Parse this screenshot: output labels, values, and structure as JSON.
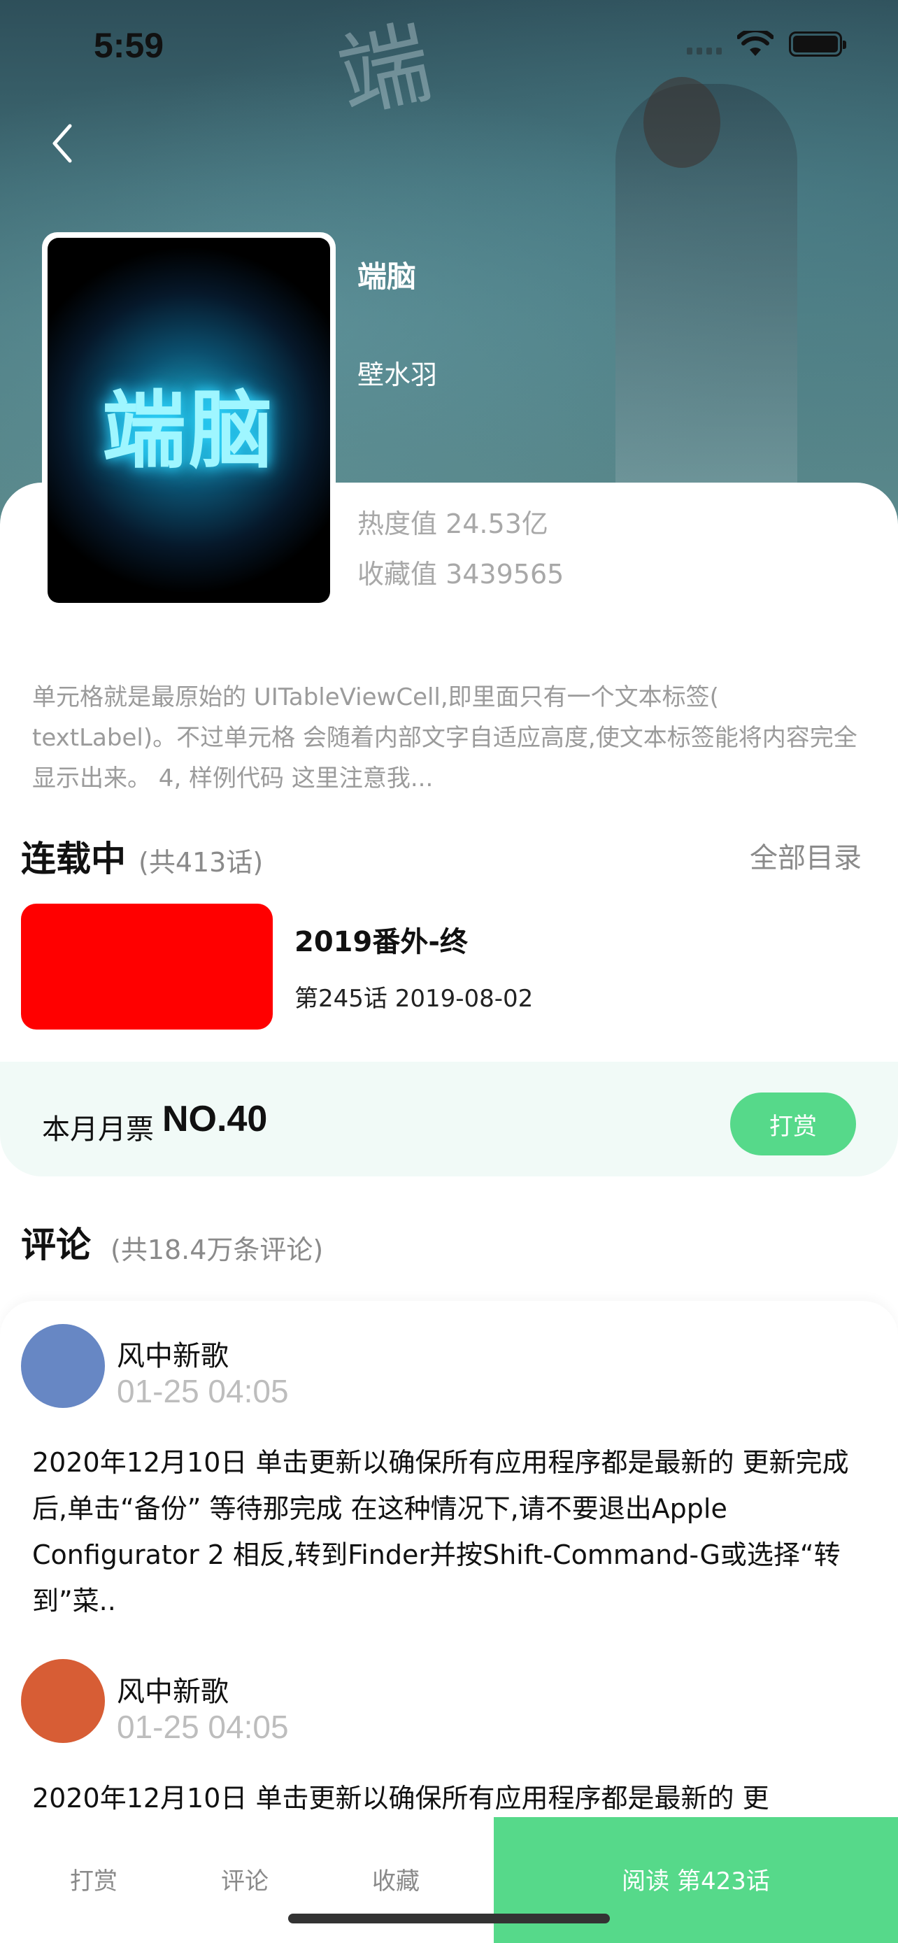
{
  "status": {
    "time": "5:59"
  },
  "comic": {
    "title": "端脑",
    "author": "壁水羽",
    "cover_title": "端脑",
    "hot_value": "热度值 24.53亿",
    "fav_value": "收藏值 3439565",
    "description": "单元格就是最原始的 UITableViewCell,即里面只有一个文本标签( textLabel)。不过单元格 会随着内部文字自适应高度,使文本标签能将内容完全显示出来。 4, 样例代码 这里注意我..."
  },
  "serial": {
    "title": "连载中",
    "count": "(共413话)",
    "all_catalog": "全部目录",
    "latest_chapter_name": "2019番外-终",
    "latest_chapter_meta": "第245话 2019-08-02"
  },
  "ticket": {
    "label": "本月月票",
    "rank": "NO.40",
    "reward_button": "打赏"
  },
  "comments": {
    "title": "评论",
    "count": "(共18.4万条评论)",
    "items": [
      {
        "user": "风中新歌",
        "time": "01-25  04:05",
        "avatar_color": "#6787c4",
        "text": "2020年12月10日 单击更新以确保所有应用程序都是最新的 更新完成后,单击“备份” 等待那完成 在这种情况下,请不要退出Apple Configurator 2 相反,转到Finder并按Shift-Command-G或选择“转到”菜.."
      },
      {
        "user": "风中新歌",
        "time": "01-25  04:05",
        "avatar_color": "#d75d35",
        "text": "2020年12月10日 单击更新以确保所有应用程序都是最新的 更"
      }
    ]
  },
  "tabbar": {
    "reward": "打赏",
    "comment": "评论",
    "favorite": "收藏",
    "read": "阅读 第423话"
  },
  "colors": {
    "accent_green": "#56d98a",
    "chapter_thumb": "#ff0000"
  }
}
